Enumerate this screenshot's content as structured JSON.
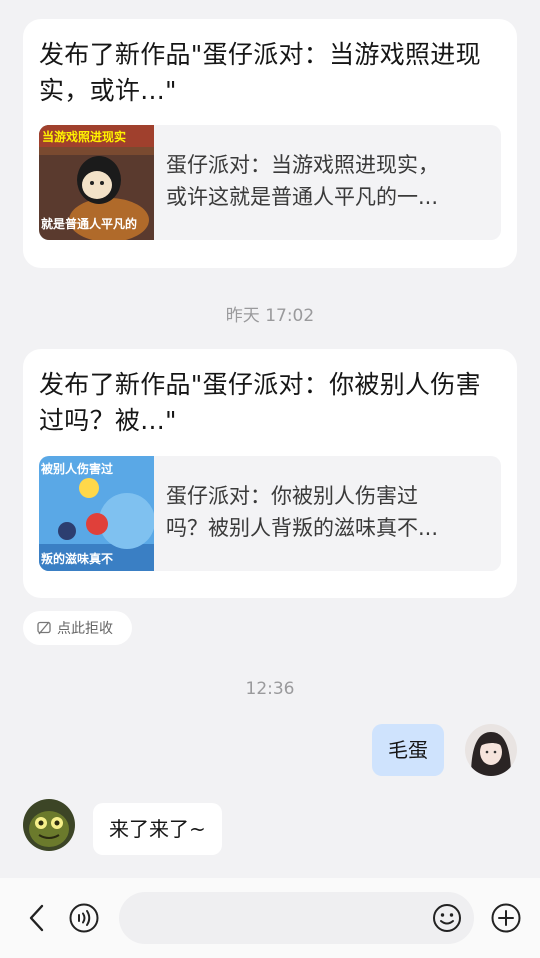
{
  "messages": {
    "card1": {
      "title": "发布了新作品\"蛋仔派对：当游戏照进现实，或许...\"",
      "desc_line1": "蛋仔派对：当游戏照进现实，",
      "desc_line2": "或许这就是普通人平凡的一...",
      "thumb_top_text": "当游戏照进现实",
      "thumb_bottom_text": "就是普通人平凡的"
    },
    "time1": "昨天 17:02",
    "card2": {
      "title": "发布了新作品\"蛋仔派对：你被别人伤害过吗？被...\"",
      "desc_line1": "蛋仔派对：你被别人伤害过",
      "desc_line2": "吗？被别人背叛的滋味真不...",
      "thumb_top_text": "被别人伤害过",
      "thumb_bottom_text": "叛的滋味真不"
    },
    "reject_label": "点此拒收",
    "time2": "12:36",
    "outgoing_text": "毛蛋",
    "incoming_text": "来了来了~"
  },
  "input": {
    "placeholder": ""
  },
  "icons": {
    "back": "back-arrow-icon",
    "voice": "voice-icon",
    "emoji": "emoji-icon",
    "plus": "plus-icon",
    "reject": "block-icon"
  },
  "colors": {
    "background": "#f2f2f4",
    "outgoing_bubble": "#cfe3fd",
    "card": "#ffffff"
  }
}
